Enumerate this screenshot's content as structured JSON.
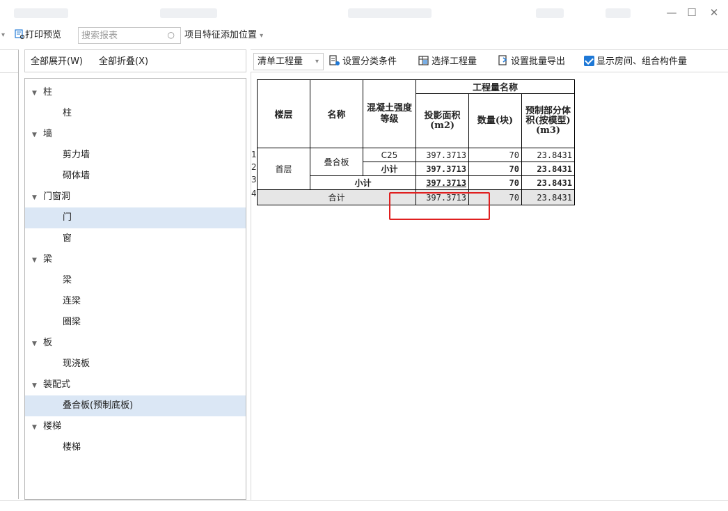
{
  "toolbar": {
    "print_preview": "打印预览",
    "search_placeholder": "搜索报表",
    "feature_position": "项目特征添加位置"
  },
  "tree_header": {
    "expand_all": "全部展开(W)",
    "collapse_all": "全部折叠(X)"
  },
  "tree": {
    "col": "柱",
    "col_leaf": "柱",
    "wall": "墙",
    "shear_wall": "剪力墙",
    "masonry_wall": "砌体墙",
    "openings": "门窗洞",
    "door": "门",
    "window": "窗",
    "beam": "梁",
    "beam_leaf": "梁",
    "coupling_beam": "连梁",
    "ring_beam": "圈梁",
    "slab": "板",
    "cast_slab": "现浇板",
    "prefab": "装配式",
    "composite_slab": "叠合板(预制底板)",
    "stair": "楼梯",
    "stair_leaf": "楼梯"
  },
  "main_toolbar": {
    "quantity_type": "清单工程量",
    "set_classification": "设置分类条件",
    "select_quantity": "选择工程量",
    "batch_export": "设置批量导出",
    "show_rooms": "显示房间、组合构件量"
  },
  "sheet": {
    "headers": {
      "floor": "楼层",
      "name": "名称",
      "concrete_grade": "混凝土强度等级",
      "quantity_group": "工程量名称",
      "projected_area": "投影面积(m2)",
      "count": "数量(块)",
      "prefab_volume": "预制部分体积(按模型)(m3)"
    },
    "row_numbers": [
      "1",
      "2",
      "3",
      "4"
    ],
    "floor_value": "首层",
    "name_value": "叠合板",
    "row1": {
      "grade": "C25",
      "area": "397.3713",
      "count": "70",
      "volume": "23.8431"
    },
    "row2": {
      "label": "小计",
      "area": "397.3713",
      "count": "70",
      "volume": "23.8431"
    },
    "row3": {
      "label": "小计",
      "area": "397.3713",
      "count": "70",
      "volume": "23.8431"
    },
    "row4": {
      "label": "合计",
      "area": "397.3713",
      "count": "70",
      "volume": "23.8431"
    }
  },
  "colors": {
    "selection": "#dbe7f5",
    "highlight_box": "#e01f1f",
    "checkbox": "#1e78d6"
  }
}
